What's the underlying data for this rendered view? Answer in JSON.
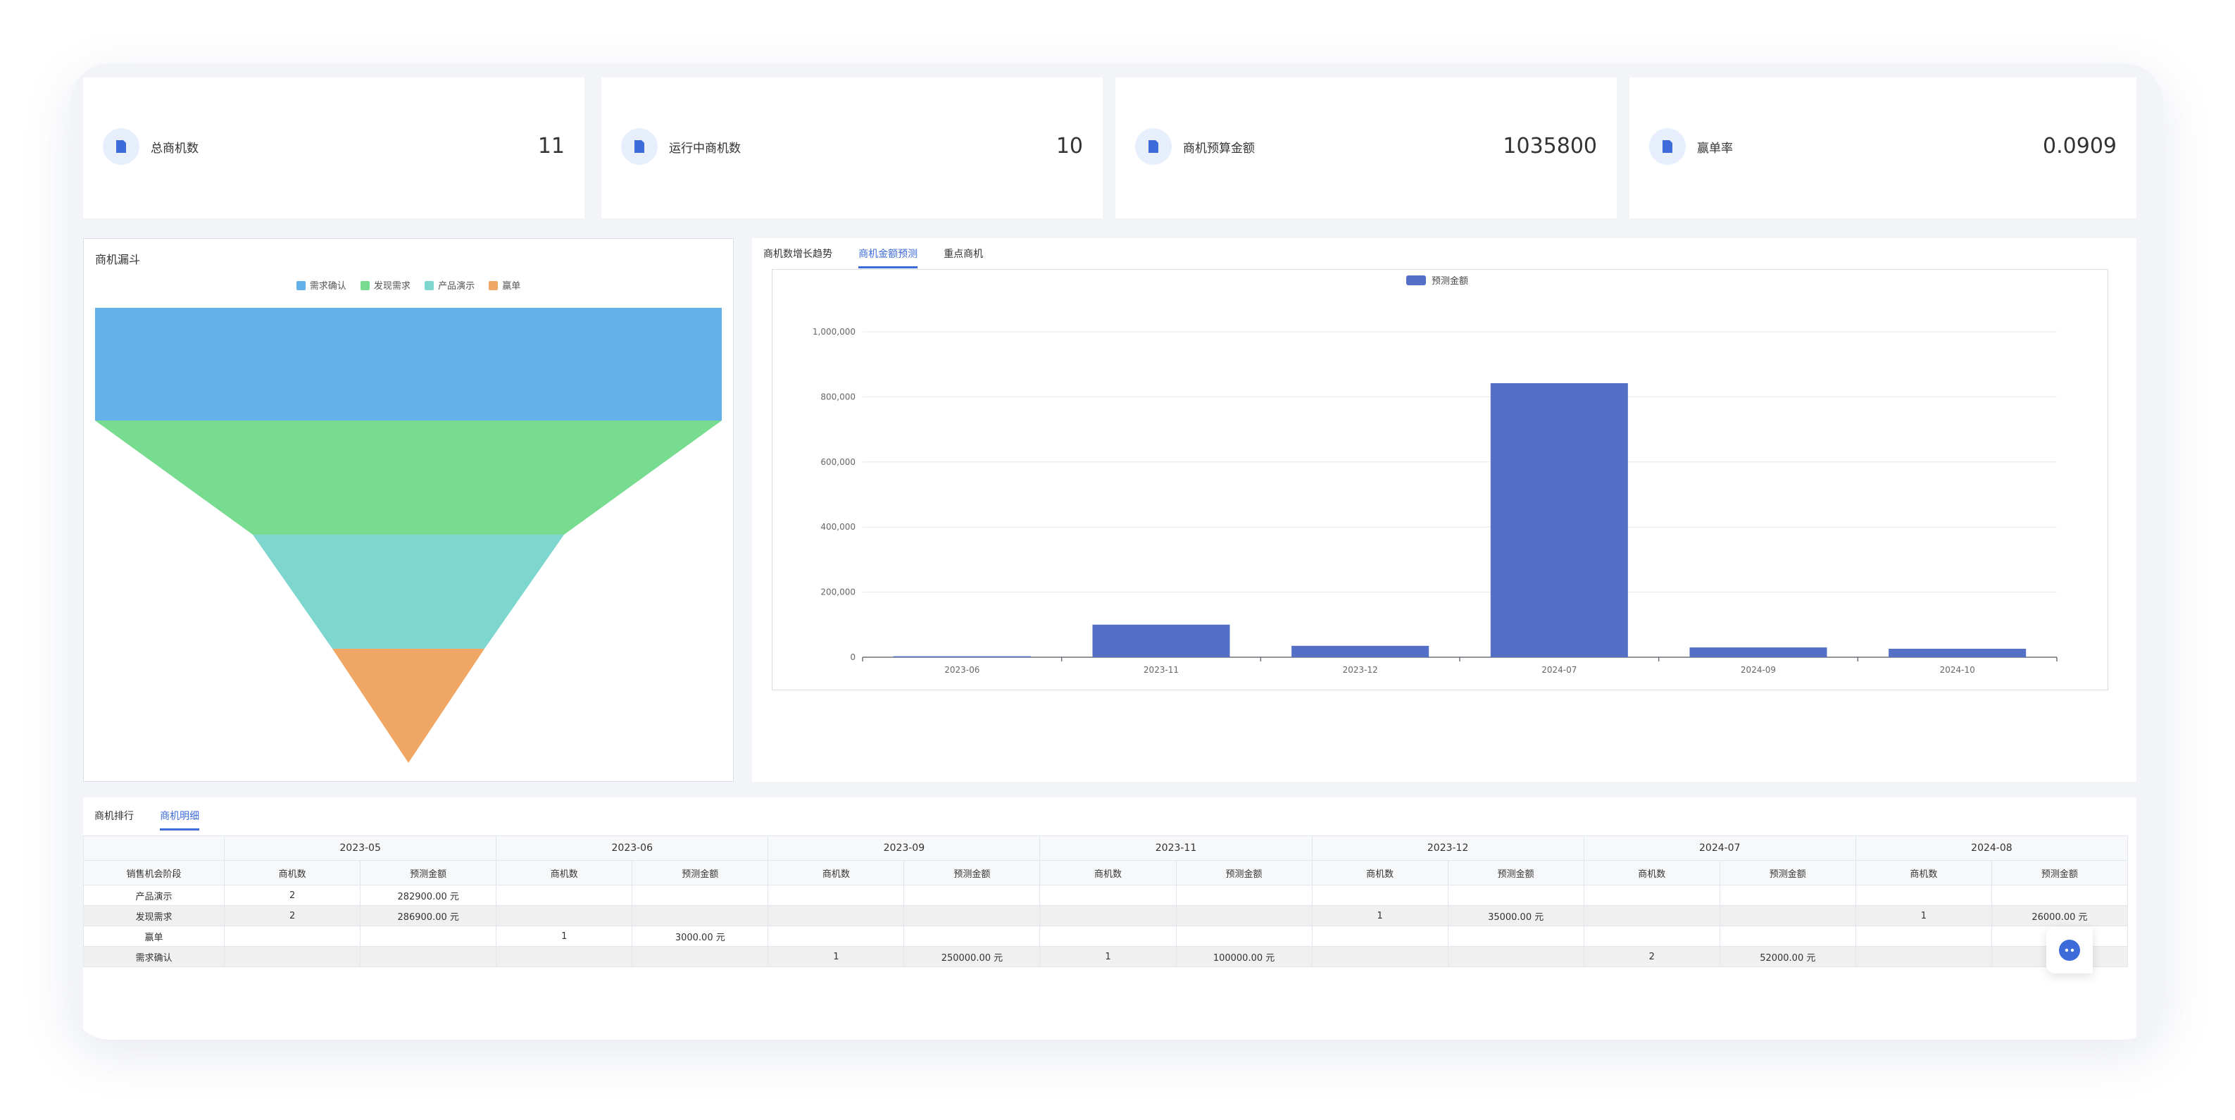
{
  "kpis": [
    {
      "label": "总商机数",
      "value": "11"
    },
    {
      "label": "运行中商机数",
      "value": "10"
    },
    {
      "label": "商机预算金额",
      "value": "1035800"
    },
    {
      "label": "赢单率",
      "value": "0.0909"
    }
  ],
  "funnel": {
    "title": "商机漏斗",
    "legend": [
      {
        "name": "需求确认",
        "color": "#64b0eb"
      },
      {
        "name": "发现需求",
        "color": "#77dc8f"
      },
      {
        "name": "产品演示",
        "color": "#7dd7cf"
      },
      {
        "name": "赢单",
        "color": "#f0a766"
      }
    ]
  },
  "right_tabs": {
    "items": [
      "商机数增长趋势",
      "商机金额预测",
      "重点商机"
    ],
    "active": 1
  },
  "chart_data": {
    "type": "bar",
    "legend": [
      "预测金额"
    ],
    "color": "#5470c6",
    "categories": [
      "2023-06",
      "2023-11",
      "2023-12",
      "2024-07",
      "2024-09",
      "2024-10"
    ],
    "values": [
      3000,
      100000,
      35000,
      842000,
      30000,
      26000
    ],
    "yticks": [
      "0",
      "200,000",
      "400,000",
      "600,000",
      "800,000",
      "1,000,000"
    ],
    "ylim": [
      0,
      1000000
    ],
    "grid": true
  },
  "bottom_tabs": {
    "items": [
      "商机排行",
      "商机明细"
    ],
    "active": 1
  },
  "table": {
    "stage_header": "销售机会阶段",
    "sub_headers": [
      "商机数",
      "预测金额"
    ],
    "periods": [
      "2023-05",
      "2023-06",
      "2023-09",
      "2023-11",
      "2023-12",
      "2024-07",
      "2024-08"
    ],
    "rows": [
      {
        "stage": "产品演示",
        "cells": [
          "2",
          "282900.00 元",
          "",
          "",
          "",
          "",
          "",
          "",
          "",
          "",
          "",
          "",
          "",
          ""
        ]
      },
      {
        "stage": "发现需求",
        "cells": [
          "2",
          "286900.00 元",
          "",
          "",
          "",
          "",
          "",
          "",
          "1",
          "35000.00 元",
          "",
          "",
          "1",
          "26000.00 元"
        ]
      },
      {
        "stage": "赢单",
        "cells": [
          "",
          "",
          "1",
          "3000.00 元",
          "",
          "",
          "",
          "",
          "",
          "",
          "",
          "",
          "",
          ""
        ]
      },
      {
        "stage": "需求确认",
        "cells": [
          "",
          "",
          "",
          "",
          "1",
          "250000.00 元",
          "1",
          "100000.00 元",
          "",
          "",
          "2",
          "52000.00 元",
          "",
          ""
        ]
      }
    ]
  }
}
